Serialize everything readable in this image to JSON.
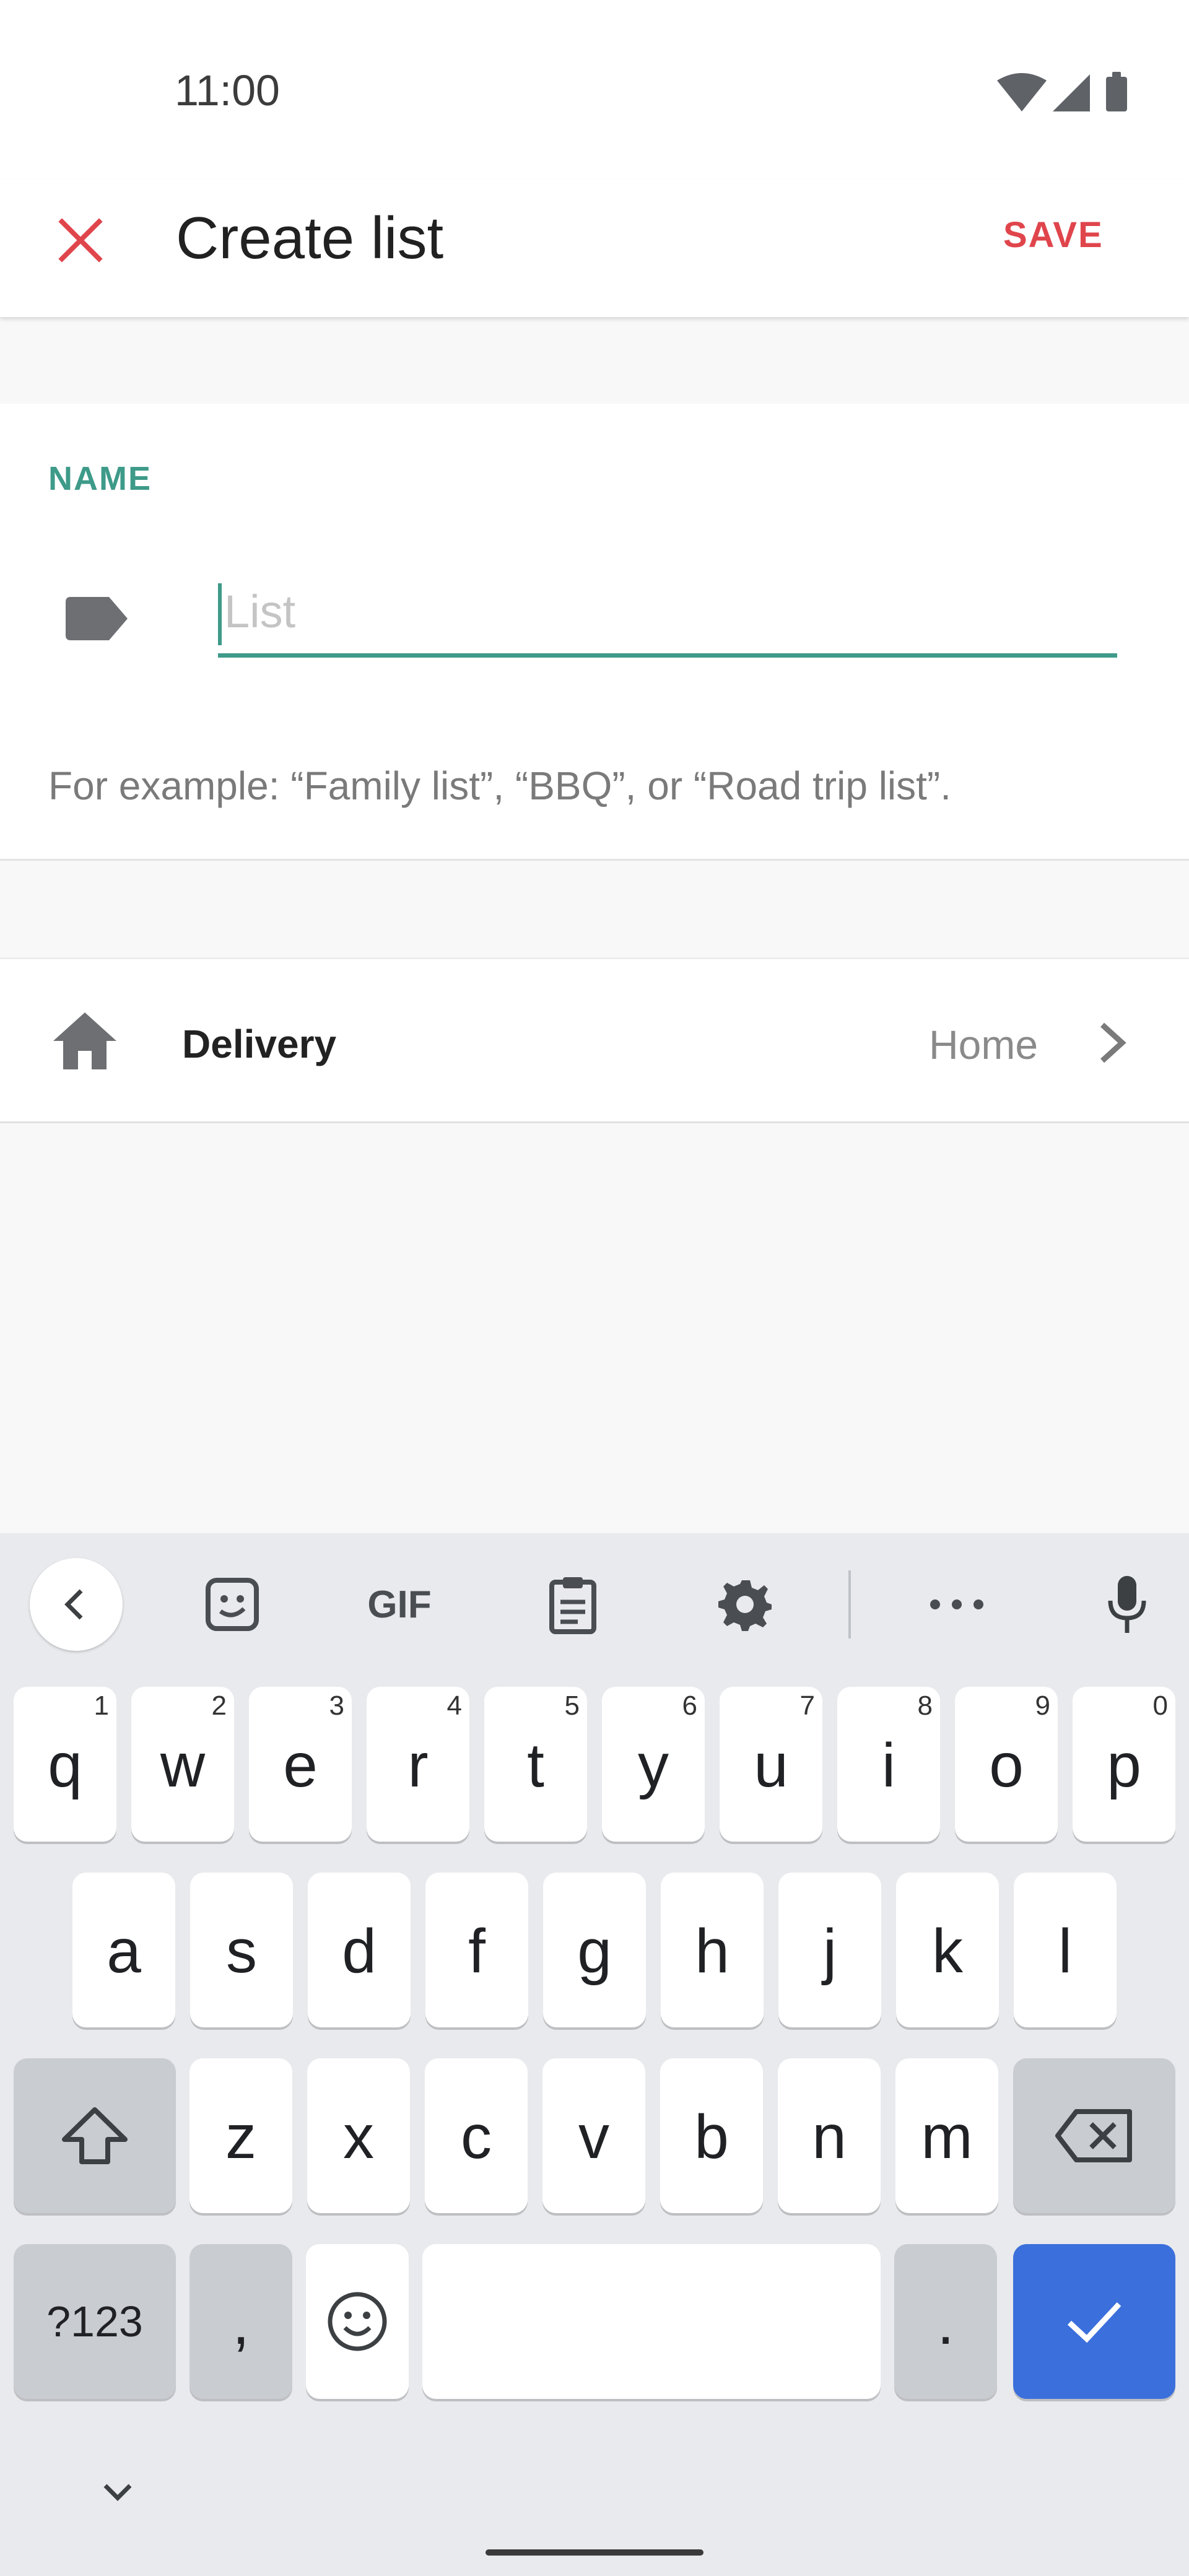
{
  "status_bar": {
    "time": "11:00",
    "icons": [
      "wifi-icon",
      "signal-icon",
      "battery-icon"
    ]
  },
  "app_bar": {
    "close_icon": "close-icon",
    "title": "Create list",
    "save_label": "SAVE"
  },
  "name_section": {
    "label": "NAME",
    "icon": "label-tag-icon",
    "input_value": "",
    "input_placeholder": "List",
    "example": "For example: “Family list”, “BBQ”, or “Road trip list”."
  },
  "delivery": {
    "icon": "home-icon",
    "label": "Delivery",
    "value": "Home",
    "chevron": "chevron-right-icon"
  },
  "keyboard": {
    "toolbar": [
      "back-icon",
      "sticker-icon",
      "gif-icon",
      "clipboard-icon",
      "settings-icon",
      "more-icon",
      "mic-icon"
    ],
    "gif_label": "GIF",
    "row1": [
      {
        "key": "q",
        "hint": "1"
      },
      {
        "key": "w",
        "hint": "2"
      },
      {
        "key": "e",
        "hint": "3"
      },
      {
        "key": "r",
        "hint": "4"
      },
      {
        "key": "t",
        "hint": "5"
      },
      {
        "key": "y",
        "hint": "6"
      },
      {
        "key": "u",
        "hint": "7"
      },
      {
        "key": "i",
        "hint": "8"
      },
      {
        "key": "o",
        "hint": "9"
      },
      {
        "key": "p",
        "hint": "0"
      }
    ],
    "row2": [
      "a",
      "s",
      "d",
      "f",
      "g",
      "h",
      "j",
      "k",
      "l"
    ],
    "row3": [
      "z",
      "x",
      "c",
      "v",
      "b",
      "n",
      "m"
    ],
    "symbols_label": "?123",
    "comma": ",",
    "period": ".",
    "colors": {
      "background": "#e8eaed",
      "key": "#ffffff",
      "dark_key": "#c9ccd1",
      "enter_key": "#3b6fdc"
    }
  },
  "colors": {
    "accent_teal": "#3e9a89",
    "accent_red": "#e0454c"
  }
}
